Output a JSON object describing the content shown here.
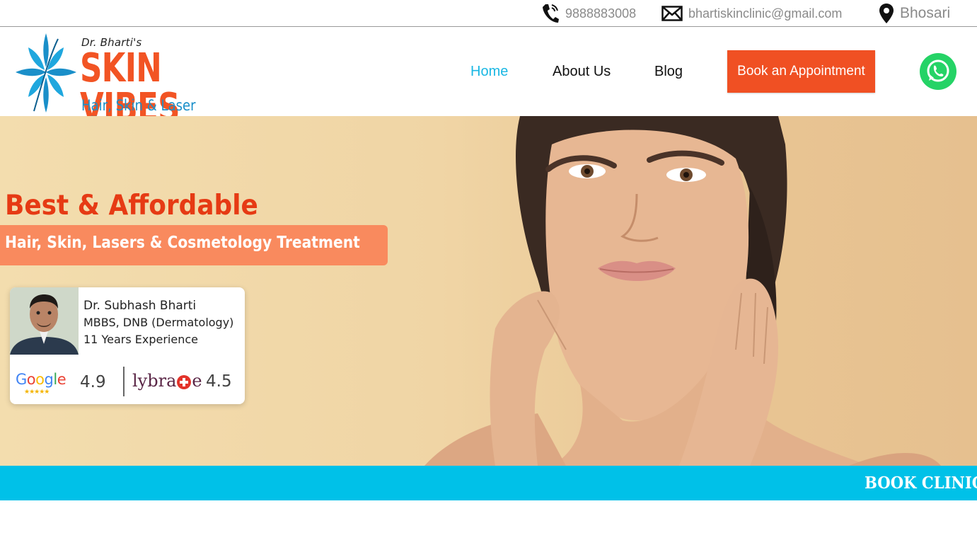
{
  "topbar": {
    "phone": "9888883008",
    "email": "bhartiskinclinic@gmail.com",
    "location": "Bhosari",
    "icons": [
      "phone-icon",
      "mail-icon",
      "location-pin-icon"
    ]
  },
  "logo": {
    "pre": "Dr. Bharti's",
    "name": "SKIN VIBES",
    "sub": "Hair, Skin & Laser Clinic"
  },
  "nav": {
    "items": [
      {
        "label": "Home",
        "active": true
      },
      {
        "label": "About Us",
        "active": false
      },
      {
        "label": "Blog",
        "active": false
      }
    ],
    "cta": "Book an Appointment",
    "whatsapp_icon": "whatsapp-icon"
  },
  "hero": {
    "title": "Best & Affordable",
    "subtitle": "Hair, Skin, Lasers & Cosmetology Treatment",
    "doctor": {
      "name": "Dr. Subhash Bharti",
      "qualification": "MBBS, DNB (Dermatology)",
      "experience": "11 Years Experience"
    },
    "ratings": {
      "google_rating": "4.9",
      "lybrate_rating": "4.5",
      "google_stars": "★★★★★"
    }
  },
  "ticker": {
    "text": "BOOK CLINIC"
  },
  "colors": {
    "accent": "#f05023",
    "nav_active": "#1ab7e3",
    "ticker_bg": "#00c1e8",
    "whatsapp": "#25d366",
    "brand_blue": "#1a8fc9"
  }
}
